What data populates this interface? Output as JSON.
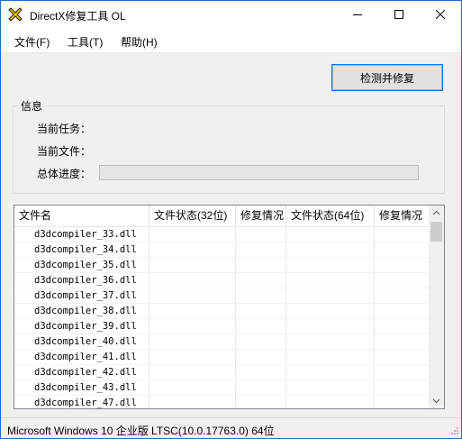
{
  "window": {
    "title": "DirectX修复工具 OL",
    "icon": "app-cross-icon",
    "accent_color": "#1c6ec8"
  },
  "menu": [
    "文件(F)",
    "工具(T)",
    "帮助(H)"
  ],
  "actions": {
    "repair_label": "检测并修复"
  },
  "info": {
    "group_title": "信息",
    "current_task_label": "当前任务：",
    "current_file_label": "当前文件：",
    "overall_progress_label": "总体进度：",
    "progress_fraction": 0
  },
  "table": {
    "columns": [
      "文件名",
      "文件状态(32位)",
      "修复情况",
      "文件状态(64位)",
      "修复情况"
    ],
    "rows": [
      "d3dcompiler_33.dll",
      "d3dcompiler_34.dll",
      "d3dcompiler_35.dll",
      "d3dcompiler_36.dll",
      "d3dcompiler_37.dll",
      "d3dcompiler_38.dll",
      "d3dcompiler_39.dll",
      "d3dcompiler_40.dll",
      "d3dcompiler_41.dll",
      "d3dcompiler_42.dll",
      "d3dcompiler_43.dll",
      "d3dcompiler_47.dll"
    ]
  },
  "status": {
    "text": "Microsoft Windows 10 企业版 LTSC(10.0.17763.0) 64位"
  }
}
